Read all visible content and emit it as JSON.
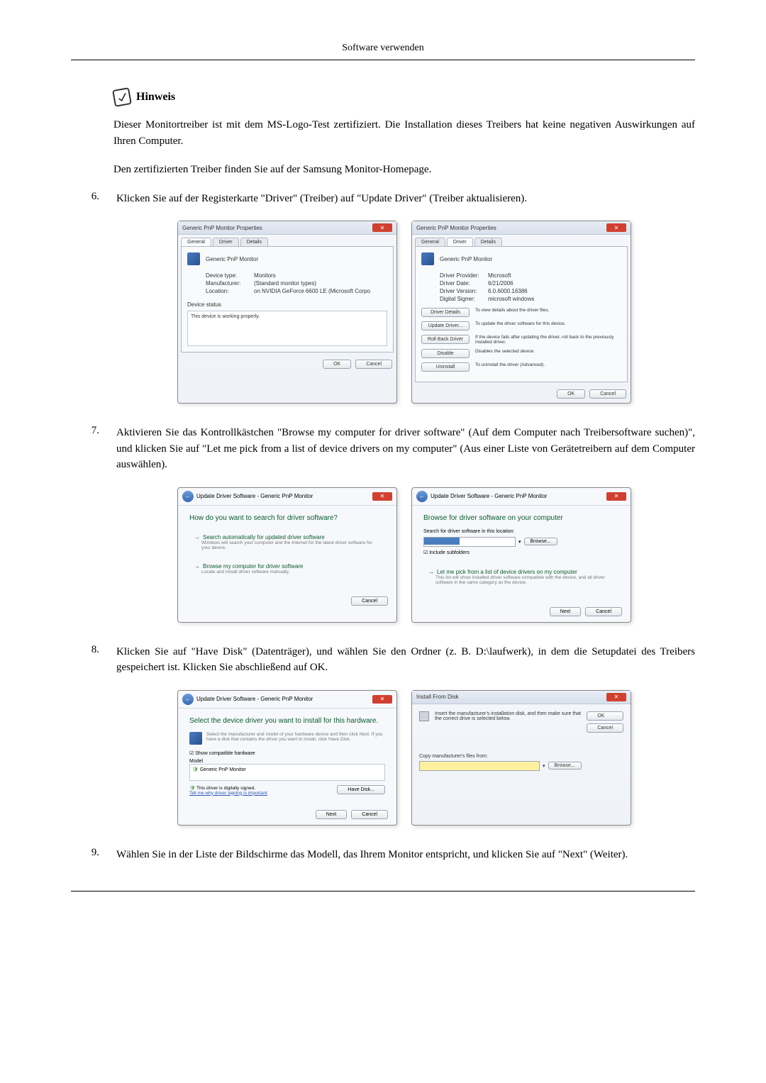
{
  "page_header": "Software verwenden",
  "hinweis": {
    "title": "Hinweis",
    "p1": "Dieser Monitortreiber ist mit dem MS-Logo-Test zertifiziert. Die Installation dieses Treibers hat keine negativen Auswirkungen auf Ihren Computer.",
    "p2": "Den zertifizierten Treiber finden Sie auf der Samsung Monitor-Homepage."
  },
  "steps": {
    "s6": {
      "num": "6.",
      "text": "Klicken Sie auf der Registerkarte \"Driver\" (Treiber) auf \"Update Driver\" (Treiber aktualisieren)."
    },
    "s7": {
      "num": "7.",
      "text": "Aktivieren Sie das Kontrollkästchen \"Browse my computer for driver software\" (Auf dem Computer nach Treibersoftware suchen)\", und klicken Sie auf \"Let me pick from a list of device drivers on my computer\" (Aus einer Liste von Gerätetreibern auf dem Computer auswählen)."
    },
    "s8": {
      "num": "8.",
      "text": "Klicken Sie auf \"Have Disk\" (Datenträger), und wählen Sie den Ordner (z. B. D:\\laufwerk), in dem die Setupdatei des Treibers gespeichert ist. Klicken Sie abschließend auf OK."
    },
    "s9": {
      "num": "9.",
      "text": "Wählen Sie in der Liste der Bildschirme das Modell, das Ihrem Monitor entspricht, und klicken Sie auf \"Next\" (Weiter)."
    }
  },
  "dlgA": {
    "title": "Generic PnP Monitor Properties",
    "tabs": {
      "general": "General",
      "driver": "Driver",
      "details": "Details"
    },
    "device_name": "Generic PnP Monitor",
    "rows": {
      "type_lbl": "Device type:",
      "type_val": "Monitors",
      "manu_lbl": "Manufacturer:",
      "manu_val": "(Standard monitor types)",
      "loc_lbl": "Location:",
      "loc_val": "on NVIDIA GeForce 6600 LE (Microsoft Corpo"
    },
    "status_lbl": "Device status",
    "status_text": "This device is working properly.",
    "ok": "OK",
    "cancel": "Cancel"
  },
  "dlgB": {
    "title": "Generic PnP Monitor Properties",
    "tabs": {
      "general": "General",
      "driver": "Driver",
      "details": "Details"
    },
    "device_name": "Generic PnP Monitor",
    "rows": {
      "prov_lbl": "Driver Provider:",
      "prov_val": "Microsoft",
      "date_lbl": "Driver Date:",
      "date_val": "6/21/2006",
      "ver_lbl": "Driver Version:",
      "ver_val": "6.0.6000.16386",
      "sign_lbl": "Digital Signer:",
      "sign_val": "microsoft windows"
    },
    "buttons": {
      "details": "Driver Details",
      "details_desc": "To view details about the driver files.",
      "update": "Update Driver...",
      "update_desc": "To update the driver software for this device.",
      "rollback": "Roll Back Driver",
      "rollback_desc": "If the device fails after updating the driver, roll back to the previously installed driver.",
      "disable": "Disable",
      "disable_desc": "Disables the selected device.",
      "uninstall": "Uninstall",
      "uninstall_desc": "To uninstall the driver (Advanced)."
    },
    "ok": "OK",
    "cancel": "Cancel"
  },
  "wizA": {
    "crumb": "Update Driver Software - Generic PnP Monitor",
    "title": "How do you want to search for driver software?",
    "opt1_t": "Search automatically for updated driver software",
    "opt1_d": "Windows will search your computer and the Internet for the latest driver software for your device.",
    "opt2_t": "Browse my computer for driver software",
    "opt2_d": "Locate and install driver software manually.",
    "cancel": "Cancel"
  },
  "wizB": {
    "crumb": "Update Driver Software - Generic PnP Monitor",
    "title": "Browse for driver software on your computer",
    "loc_lbl": "Search for driver software in this location:",
    "browse": "Browse...",
    "include": "Include subfolders",
    "opt_t": "Let me pick from a list of device drivers on my computer",
    "opt_d": "This list will show installed driver software compatible with the device, and all driver software in the same category as the device.",
    "next": "Next",
    "cancel": "Cancel"
  },
  "wizC": {
    "crumb": "Update Driver Software - Generic PnP Monitor",
    "title": "Select the device driver you want to install for this hardware.",
    "desc": "Select the manufacturer and model of your hardware device and then click Next. If you have a disk that contains the driver you want to install, click Have Disk.",
    "compat": "Show compatible hardware",
    "model_lbl": "Model",
    "model_item": "Generic PnP Monitor",
    "signed": "This driver is digitally signed.",
    "why": "Tell me why driver signing is important",
    "have_disk": "Have Disk...",
    "next": "Next",
    "cancel": "Cancel"
  },
  "dlgD": {
    "title": "Install From Disk",
    "instr": "Insert the manufacturer's installation disk, and then make sure that the correct drive is selected below.",
    "copy_lbl": "Copy manufacturer's files from:",
    "browse": "Browse...",
    "ok": "OK",
    "cancel": "Cancel"
  }
}
